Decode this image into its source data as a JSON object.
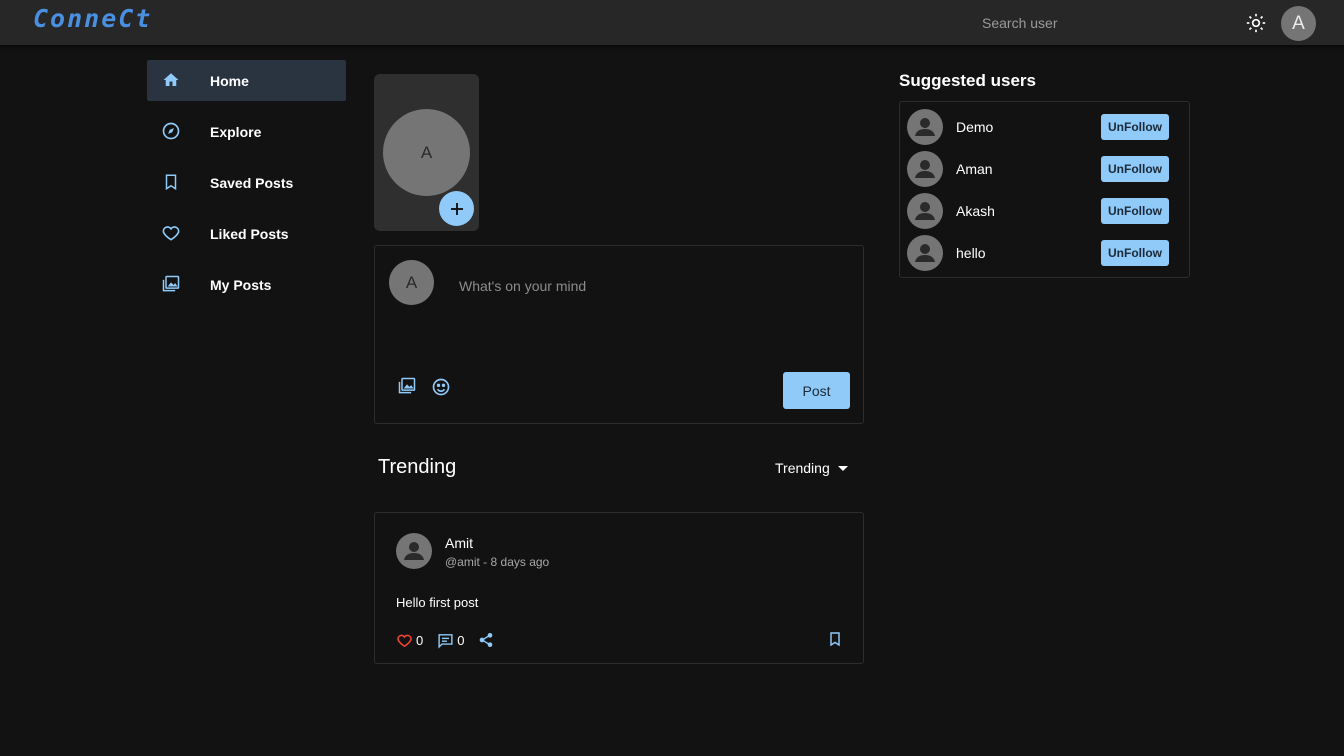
{
  "header": {
    "logo": "ConneCt",
    "search_placeholder": "Search user",
    "user_initial": "A",
    "theme_icon": "sun-icon"
  },
  "sidebar": {
    "items": [
      {
        "label": "Home",
        "icon": "home-icon",
        "active": true
      },
      {
        "label": "Explore",
        "icon": "compass-icon",
        "active": false
      },
      {
        "label": "Saved Posts",
        "icon": "bookmark-icon",
        "active": false
      },
      {
        "label": "Liked Posts",
        "icon": "heart-icon",
        "active": false
      },
      {
        "label": "My Posts",
        "icon": "photo-library-icon",
        "active": false
      }
    ]
  },
  "story": {
    "initial": "A",
    "add_label": "+"
  },
  "composer": {
    "initial": "A",
    "placeholder": "What's on your mind",
    "post_label": "Post"
  },
  "feed": {
    "title": "Trending",
    "sort_selected": "Trending",
    "posts": [
      {
        "author": "Amit",
        "meta": "@amit - 8 days ago",
        "body": "Hello first post",
        "likes": "0",
        "comments": "0"
      }
    ]
  },
  "suggested": {
    "title": "Suggested users",
    "users": [
      {
        "name": "Demo",
        "action": "UnFollow"
      },
      {
        "name": "Aman",
        "action": "UnFollow"
      },
      {
        "name": "Akash",
        "action": "UnFollow"
      },
      {
        "name": "hello",
        "action": "UnFollow"
      }
    ]
  },
  "colors": {
    "background": "#121212",
    "topbar": "#272727",
    "accent": "#90caf9",
    "logo": "#4a8fe0",
    "like": "#f44336",
    "active_nav": "#2a3340"
  }
}
